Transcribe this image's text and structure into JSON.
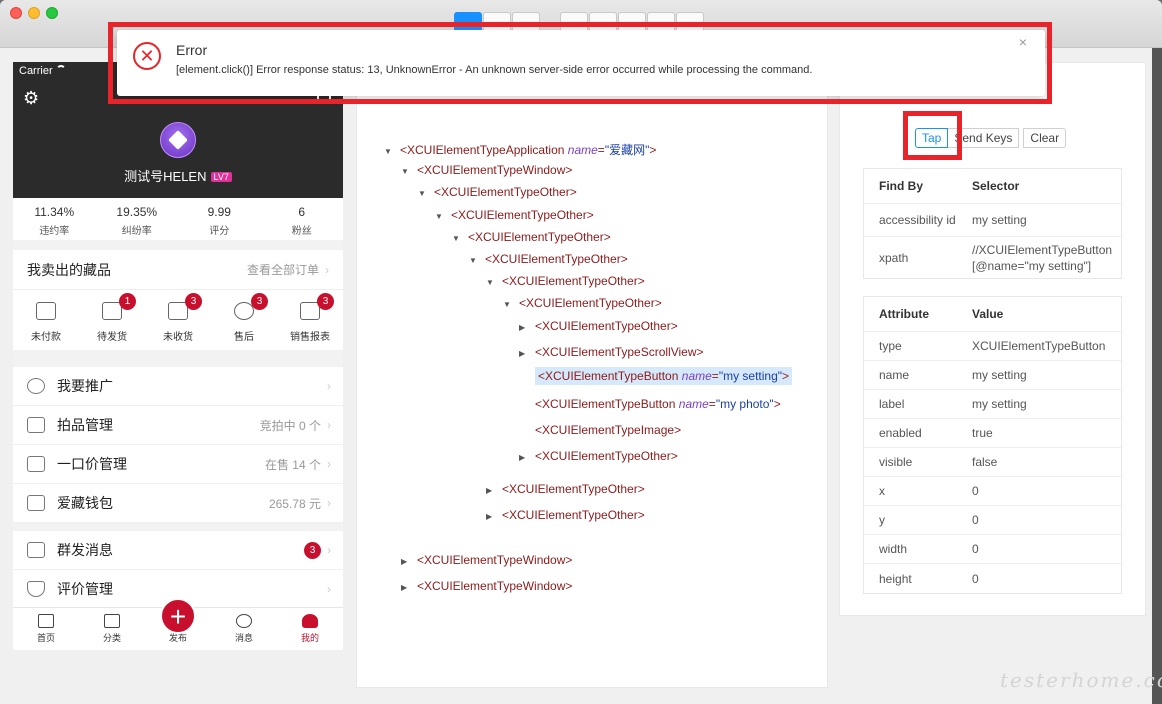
{
  "phone": {
    "status": {
      "carrier": "Carrier"
    },
    "user": {
      "name": "测试号HELEN",
      "level": "LV7"
    },
    "stats": [
      {
        "value": "11.34%",
        "label": "违约率"
      },
      {
        "value": "19.35%",
        "label": "纠纷率"
      },
      {
        "value": "9.99",
        "label": "评分"
      },
      {
        "value": "6",
        "label": "粉丝"
      }
    ],
    "sold": {
      "title": "我卖出的藏品",
      "more": "查看全部订单"
    },
    "orders": [
      {
        "label": "未付款",
        "badge": ""
      },
      {
        "label": "待发货",
        "badge": "1"
      },
      {
        "label": "未收货",
        "badge": "3"
      },
      {
        "label": "售后",
        "badge": "3"
      },
      {
        "label": "销售报表",
        "badge": "3"
      }
    ],
    "menu1": [
      {
        "label": "我要推广",
        "right": ""
      },
      {
        "label": "拍品管理",
        "right": "竞拍中 0 个"
      },
      {
        "label": "一口价管理",
        "right": "在售 14 个"
      },
      {
        "label": "爱藏钱包",
        "right": "265.78 元"
      }
    ],
    "menu2": [
      {
        "label": "群发消息",
        "badge": "3"
      },
      {
        "label": "评价管理",
        "badge": ""
      }
    ],
    "tabs": [
      {
        "label": "首页"
      },
      {
        "label": "分类"
      },
      {
        "label": "发布"
      },
      {
        "label": "消息"
      },
      {
        "label": "我的"
      }
    ]
  },
  "tree": {
    "app": {
      "tag": "<XCUIElementTypeApplication",
      "attr": "name",
      "val": "\"爱藏网\"",
      "end": ">"
    },
    "nodes": [
      "<XCUIElementTypeWindow>",
      "<XCUIElementTypeOther>",
      "<XCUIElementTypeOther>",
      "<XCUIElementTypeOther>",
      "<XCUIElementTypeOther>",
      "<XCUIElementTypeOther>",
      "<XCUIElementTypeOther>",
      "<XCUIElementTypeOther>",
      "<XCUIElementTypeScrollView>",
      "<XCUIElementTypeImage>",
      "<XCUIElementTypeOther>",
      "<XCUIElementTypeOther>",
      "<XCUIElementTypeOther>",
      "<XCUIElementTypeWindow>",
      "<XCUIElementTypeWindow>"
    ],
    "button1": {
      "tag": "<XCUIElementTypeButton",
      "attr": "name",
      "val": "\"my setting\"",
      "end": ">"
    },
    "button2": {
      "tag": "<XCUIElementTypeButton",
      "attr": "name",
      "val": "\"my photo\"",
      "end": ">"
    }
  },
  "inspector": {
    "actions": {
      "tap": "Tap",
      "send_keys": "Send Keys",
      "clear": "Clear"
    },
    "find": {
      "headers": {
        "c1": "Find By",
        "c2": "Selector"
      },
      "rows": [
        {
          "k": "accessibility id",
          "v": "my setting"
        },
        {
          "k": "xpath",
          "v": "//XCUIElementTypeButton[@name=\"my setting\"]"
        }
      ]
    },
    "attrs": {
      "headers": {
        "c1": "Attribute",
        "c2": "Value"
      },
      "rows": [
        {
          "k": "type",
          "v": "XCUIElementTypeButton"
        },
        {
          "k": "name",
          "v": "my setting"
        },
        {
          "k": "label",
          "v": "my setting"
        },
        {
          "k": "enabled",
          "v": "true"
        },
        {
          "k": "visible",
          "v": "false"
        },
        {
          "k": "x",
          "v": "0"
        },
        {
          "k": "y",
          "v": "0"
        },
        {
          "k": "width",
          "v": "0"
        },
        {
          "k": "height",
          "v": "0"
        }
      ]
    }
  },
  "error": {
    "title": "Error",
    "message": "[element.click()] Error response status: 13, UnknownError - An unknown server-side error occurred while processing the command."
  },
  "watermark": "testerhome.com",
  "colors": {
    "error_red": "#e8242a",
    "brand_red": "#c8102e",
    "link_blue": "#1890ff"
  }
}
